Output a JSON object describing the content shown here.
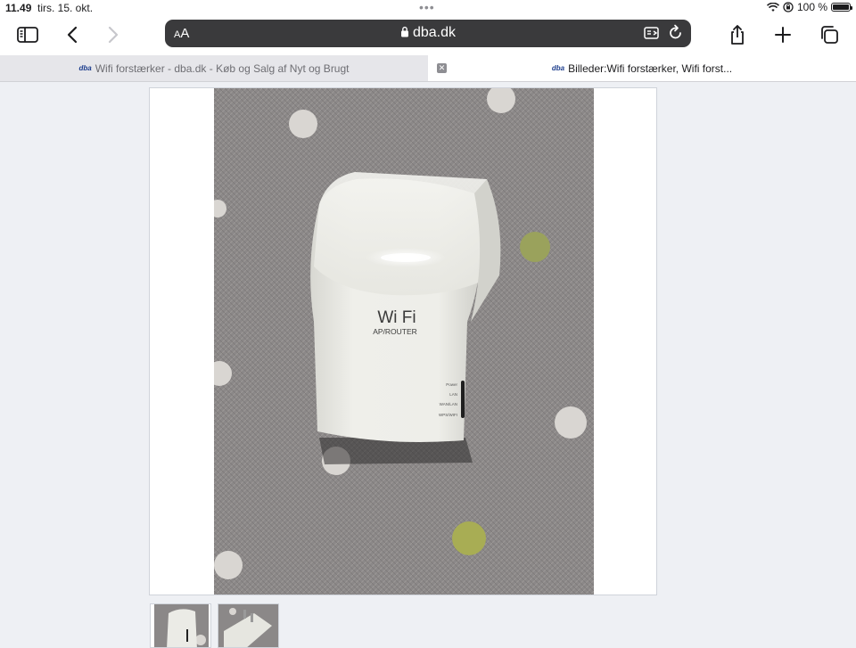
{
  "status_bar": {
    "time": "11.49",
    "date": "tirs. 15. okt.",
    "battery": "100 %",
    "battery_level_percent": 100
  },
  "toolbar": {
    "text_size_label": "AA",
    "url": "dba.dk",
    "icons": [
      "sidebar-icon",
      "back-icon",
      "forward-icon",
      "lock-icon",
      "reader-icon",
      "reload-icon",
      "share-icon",
      "new-tab-icon",
      "tabs-icon"
    ]
  },
  "tabs": [
    {
      "logo": "dba",
      "title": "Wifi forstærker - dba.dk - Køb og Salg af Nyt og Brugt",
      "active": false
    },
    {
      "logo": "dba",
      "title": "Billeder:Wifi forstærker, Wifi forst...",
      "active": true
    }
  ],
  "photo": {
    "device_brand_text": "Wi Fi",
    "device_model_text": "AP/ROUTER",
    "led_labels": [
      "Power",
      "LAN",
      "WAN/LAN",
      "WPS/WIFI"
    ]
  },
  "thumbnails": [
    {
      "name": "thumbnail-1"
    },
    {
      "name": "thumbnail-2"
    }
  ],
  "colors": {
    "address_bar": "#3a3a3c",
    "active_tab": "#ffffff",
    "inactive_tab": "#e6e6ea",
    "page_background": "#eef0f4",
    "carpet": "#8b8888",
    "device": "#ebebe6",
    "dot_white": "#d9d6d2",
    "dot_green": "#9aa25c"
  }
}
